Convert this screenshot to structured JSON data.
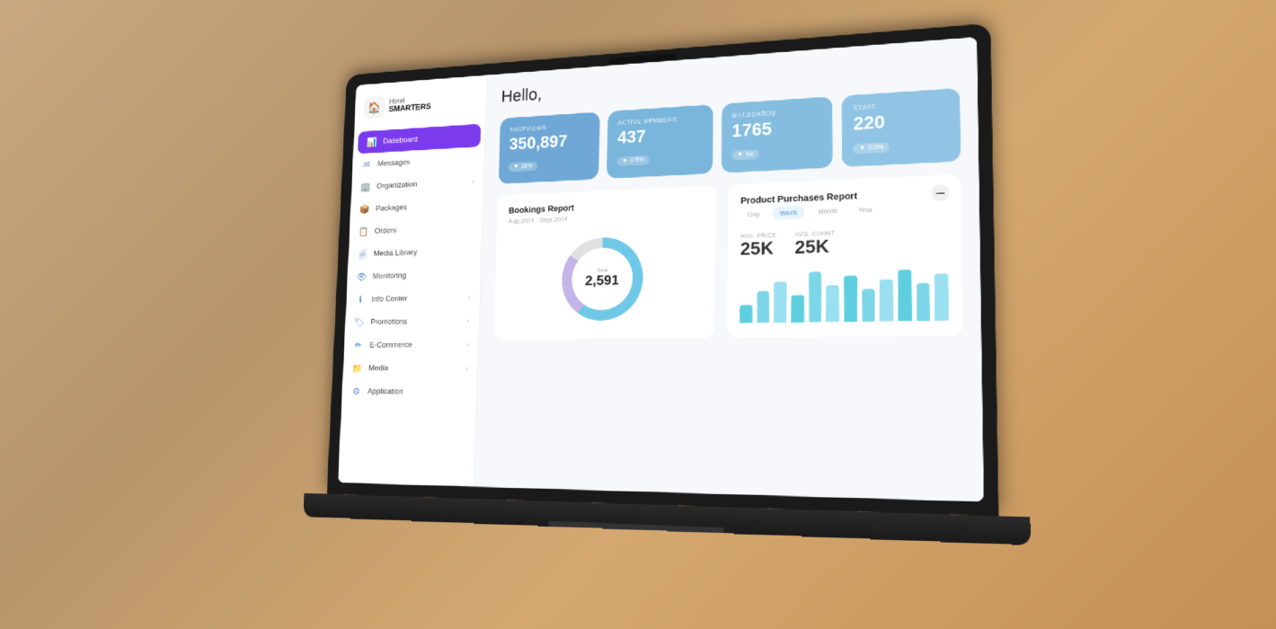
{
  "logo": {
    "hotel_text": "Hotel",
    "smarters_text": "SMARTERS"
  },
  "sidebar": {
    "items": [
      {
        "id": "dashboard",
        "label": "Daseboard",
        "icon": "📊",
        "active": true,
        "has_chevron": false
      },
      {
        "id": "messages",
        "label": "Messages",
        "icon": "✉",
        "active": false,
        "has_chevron": false
      },
      {
        "id": "organization",
        "label": "Organization",
        "icon": "🏢",
        "active": false,
        "has_chevron": true
      },
      {
        "id": "packages",
        "label": "Packages",
        "icon": "📦",
        "active": false,
        "has_chevron": false
      },
      {
        "id": "orders",
        "label": "Orders",
        "icon": "📋",
        "active": false,
        "has_chevron": false
      },
      {
        "id": "media-library",
        "label": "Media Library",
        "icon": "🖼",
        "active": false,
        "has_chevron": false
      },
      {
        "id": "monitoring",
        "label": "Monitoring",
        "icon": "👁",
        "active": false,
        "has_chevron": false
      },
      {
        "id": "info-center",
        "label": "Info Center",
        "icon": "ℹ",
        "active": false,
        "has_chevron": true
      },
      {
        "id": "promotions",
        "label": "Promotions",
        "icon": "🏷",
        "active": false,
        "has_chevron": true
      },
      {
        "id": "ecommerce",
        "label": "E-Commerce",
        "icon": "✏",
        "active": false,
        "has_chevron": true
      },
      {
        "id": "media",
        "label": "Media",
        "icon": "📁",
        "active": false,
        "has_chevron": true
      },
      {
        "id": "application",
        "label": "Application",
        "icon": "⚙",
        "active": false,
        "has_chevron": false
      }
    ]
  },
  "main": {
    "greeting": "Hello,",
    "stats": [
      {
        "label": "PAGEVIEWS",
        "value": "350,897",
        "badge": "16%"
      },
      {
        "label": "ACTIVE MEMBERS",
        "value": "437",
        "badge": "0.5%"
      },
      {
        "label": "BILLBOARDS",
        "value": "1765",
        "badge": "No"
      },
      {
        "label": "STAFF",
        "value": "220",
        "badge": "0.5%"
      }
    ],
    "bookings_report": {
      "title": "Bookings Report",
      "subtitle": "Aug 2024 - Sept 2024",
      "total_label": "Total",
      "total_value": "2,591",
      "donut_segments": [
        {
          "value": 60,
          "color": "#6fc8e8"
        },
        {
          "value": 25,
          "color": "#c5b4e8"
        },
        {
          "value": 15,
          "color": "#e0e0e0"
        }
      ]
    },
    "purchases_report": {
      "title": "Product Purchases Report",
      "filters": [
        "Day",
        "Week",
        "Month",
        "Year"
      ],
      "active_filter": "Week",
      "metric1_label": "AVG. PRICE",
      "metric1_value": "25K",
      "metric2_label": "AVG. COUNT",
      "metric2_value": "25K",
      "bar_heights": [
        20,
        35,
        45,
        30,
        55,
        40,
        50,
        35,
        45,
        55,
        40,
        50
      ]
    }
  }
}
